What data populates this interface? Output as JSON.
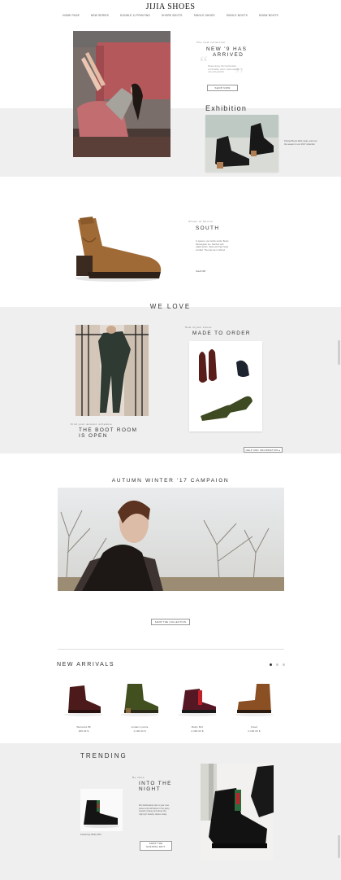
{
  "header": {
    "brand": "JIJIA SHOES",
    "nav": [
      "HOME PAGE",
      "NEW SERIES",
      "DOUBLE 11 PRINTING",
      "SHORE BOOTS",
      "SINGLE SHOES",
      "SINGLE BOOTS",
      "SNOW BOOTS"
    ]
  },
  "hero": {
    "kicker": "The new collection",
    "title_line1": "NEW   '9 HAS",
    "title_line2": "ARRIVED",
    "body": "Please Enjoy this Fashionable, comfortable, warm, sweet elegant new and graceful",
    "button": "SHOP NOW",
    "exhibition_title": "Exhibition",
    "product_caption": "Pointed Boots Well made, and now the season to our 2017 collection"
  },
  "south": {
    "kicker": "Shoes of Series",
    "title": "SOUTH",
    "body": "In spaces, new textile works. Boots Rectangular toe. Stitched with naked polish. Spats and high heels scrolled. The pole toe is refined",
    "link": "South IIM"
  },
  "we_love": {
    "title": "WE LOVE",
    "mto_kicker": "New styles shoes",
    "mto_title": "MADE TO ORDER",
    "boot_kicker": "Find your autumn schedule",
    "boot_title_line1": "THE BOOT ROOM",
    "boot_title_line2": "IS OPEN",
    "help_button": "HELP AND INFORMATION  ▸"
  },
  "campaign": {
    "title": "AUTUMN WINTER '17 CAMPAIGN",
    "button": "SHOP THE COLLECTION"
  },
  "new_arrivals": {
    "title": "NEW ARRIVALS",
    "items": [
      {
        "name": "Warrants 88",
        "price": "489.00 $"
      },
      {
        "name": "Jordan's partie",
        "price": "1,190.00 $"
      },
      {
        "name": "Bulky 503",
        "price": "2,390.00 $"
      },
      {
        "name": "Cloud",
        "price": "2,190.00 $"
      }
    ]
  },
  "trending": {
    "title": "TRENDING",
    "kicker": "By shoe",
    "headline_line1": "INTO THE",
    "headline_line2": "NIGHT",
    "body": "We fashionably clan is your new sweet and soft taboo in the party Jewelry Classy and dress the night girl Jewelry dance today",
    "caption": "Featuring: Bulky 503",
    "button_line1": "SHOP THE",
    "button_line2": "EVENING EDIT"
  },
  "colors": {
    "band": "#efefef",
    "text": "#222222"
  }
}
